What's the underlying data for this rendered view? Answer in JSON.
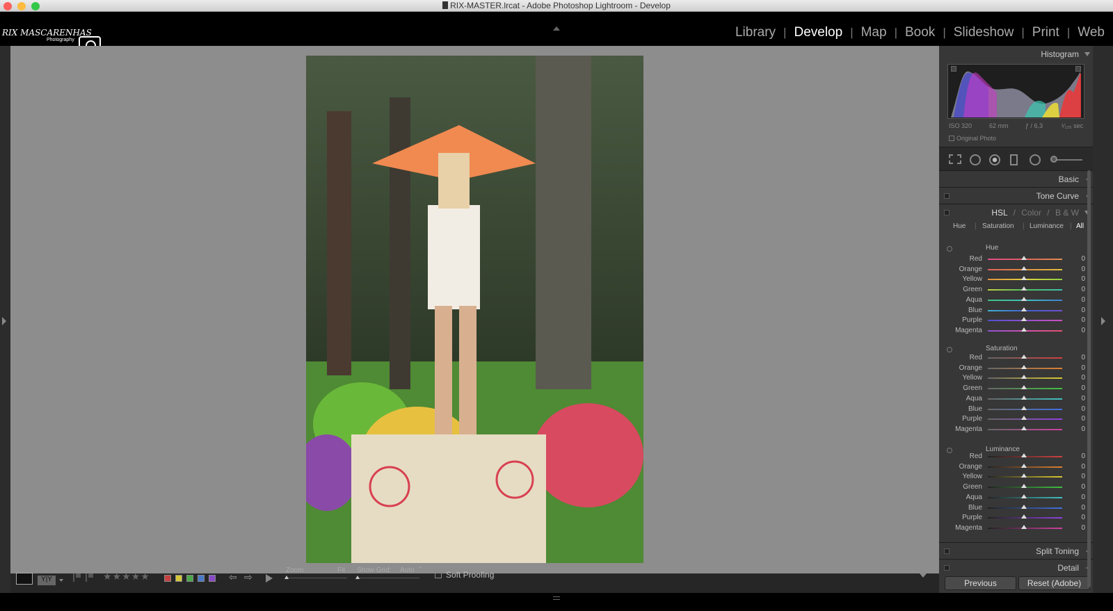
{
  "window": {
    "title": "RIX-MASTER.lrcat - Adobe Photoshop Lightroom - Develop"
  },
  "logo": {
    "name": "RIX MASCARENHAS",
    "tagline": "Photography"
  },
  "modules": [
    {
      "label": "Library",
      "active": false
    },
    {
      "label": "Develop",
      "active": true
    },
    {
      "label": "Map",
      "active": false
    },
    {
      "label": "Book",
      "active": false
    },
    {
      "label": "Slideshow",
      "active": false
    },
    {
      "label": "Print",
      "active": false
    },
    {
      "label": "Web",
      "active": false
    }
  ],
  "module_separator": "|",
  "histogram": {
    "title": "Histogram",
    "iso": "ISO 320",
    "focal": "62 mm",
    "aperture": "ƒ / 6,3",
    "shutter": "¹⁄₁₂₅ sec",
    "original_photo_label": "Original Photo"
  },
  "panels": {
    "basic": "Basic",
    "tone_curve": "Tone Curve",
    "hsl": "HSL",
    "color": "Color",
    "bw": "B & W",
    "slash": "/",
    "split_toning": "Split Toning",
    "detail": "Detail"
  },
  "hsl_tabs": {
    "hue": "Hue",
    "saturation": "Saturation",
    "luminance": "Luminance",
    "all": "All"
  },
  "groups": [
    {
      "title": "Hue",
      "rows": [
        {
          "label": "Red",
          "value": "0"
        },
        {
          "label": "Orange",
          "value": "0"
        },
        {
          "label": "Yellow",
          "value": "0"
        },
        {
          "label": "Green",
          "value": "0"
        },
        {
          "label": "Aqua",
          "value": "0"
        },
        {
          "label": "Blue",
          "value": "0"
        },
        {
          "label": "Purple",
          "value": "0"
        },
        {
          "label": "Magenta",
          "value": "0"
        }
      ]
    },
    {
      "title": "Saturation",
      "rows": [
        {
          "label": "Red",
          "value": "0"
        },
        {
          "label": "Orange",
          "value": "0"
        },
        {
          "label": "Yellow",
          "value": "0"
        },
        {
          "label": "Green",
          "value": "0"
        },
        {
          "label": "Aqua",
          "value": "0"
        },
        {
          "label": "Blue",
          "value": "0"
        },
        {
          "label": "Purple",
          "value": "0"
        },
        {
          "label": "Magenta",
          "value": "0"
        }
      ]
    },
    {
      "title": "Luminance",
      "rows": [
        {
          "label": "Red",
          "value": "0"
        },
        {
          "label": "Orange",
          "value": "0"
        },
        {
          "label": "Yellow",
          "value": "0"
        },
        {
          "label": "Green",
          "value": "0"
        },
        {
          "label": "Aqua",
          "value": "0"
        },
        {
          "label": "Blue",
          "value": "0"
        },
        {
          "label": "Purple",
          "value": "0"
        },
        {
          "label": "Magenta",
          "value": "0"
        }
      ]
    }
  ],
  "toolbar": {
    "zoom_label": "Zoom",
    "zoom_value": "Fit",
    "show_grid_label": "Show Grid:",
    "show_grid_value": "Auto",
    "soft_proofing": "Soft Proofing",
    "rating_stars": "★★★★★",
    "view_yy": "Y|Y"
  },
  "buttons": {
    "previous": "Previous",
    "reset": "Reset (Adobe)"
  },
  "colors": {
    "panel_bg": "#373737",
    "canvas_bg": "#8d8d8d",
    "label_red": "#c84040",
    "label_yellow": "#d4c83a",
    "label_green": "#4aa84a",
    "label_blue": "#4a78c8",
    "label_purple": "#8a4ac8"
  }
}
